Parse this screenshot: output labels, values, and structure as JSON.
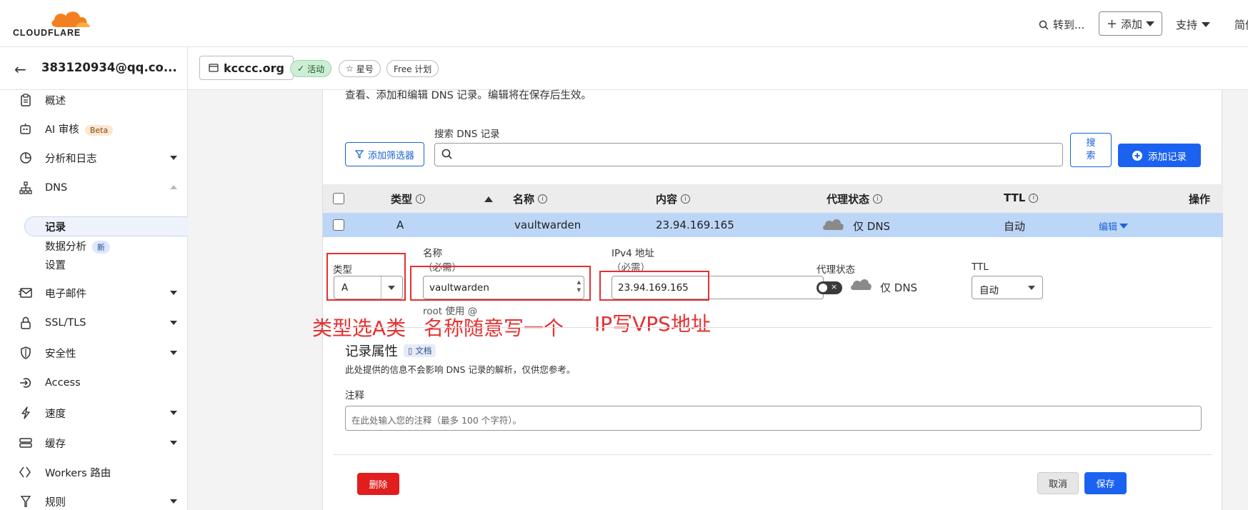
{
  "brand": {
    "wordmark": "CLOUDFLARE",
    "orange": "#f38020"
  },
  "topbar": {
    "goto": "转到...",
    "add": "添加",
    "support": "支持",
    "lang": "简体"
  },
  "account": {
    "email": "383120934@qq.co..."
  },
  "sidebar": {
    "overview": "概述",
    "ai_audit": "AI 审核",
    "beta": "Beta",
    "analytics": "分析和日志",
    "dns": "DNS",
    "records": "记录",
    "dns_analytics": "数据分析",
    "new": "新",
    "settings": "设置",
    "email": "电子邮件",
    "ssl": "SSL/TLS",
    "security": "安全性",
    "access": "Access",
    "speed": "速度",
    "cache": "缓存",
    "workers": "Workers 路由",
    "rules": "规则"
  },
  "domainbar": {
    "domain": "kcccc.org",
    "status": "活动",
    "star": "星号",
    "plan": "Free 计划"
  },
  "dns": {
    "description": "查看、添加和编辑 DNS 记录。编辑将在保存后生效。",
    "search_label": "搜索 DNS 记录",
    "filter_button": "添加筛选器",
    "search_button": "搜索",
    "add_record_button": "添加记录",
    "columns": {
      "type": "类型",
      "name": "名称",
      "content": "内容",
      "proxy": "代理状态",
      "ttl": "TTL",
      "actions": "操作"
    },
    "row": {
      "type": "A",
      "name": "vaultwarden",
      "content": "23.94.169.165",
      "proxy": "仅 DNS",
      "ttl": "自动",
      "edit": "编辑"
    }
  },
  "edit_form": {
    "type_label": "类型",
    "type_value": "A",
    "name_label": "名称",
    "name_required": "（必需）",
    "name_value": "vaultwarden",
    "name_hint": "root 使用 @",
    "ipv4_label": "IPv4 地址",
    "ipv4_required": "（必需）",
    "ipv4_value": "23.94.169.165",
    "proxy_label": "代理状态",
    "proxy_value": "仅 DNS",
    "ttl_label": "TTL",
    "ttl_value": "自动",
    "record_attrs_title": "记录属性",
    "doc_label": "文档",
    "record_attrs_desc": "此处提供的信息不会影响 DNS 记录的解析，仅供您参考。",
    "note_label": "注释",
    "note_placeholder": "在此处输入您的注释（最多 100 个字符）。",
    "delete_button": "删除",
    "cancel_button": "取消",
    "save_button": "保存"
  },
  "annotations": {
    "type_note": "类型选A类",
    "name_note": "名称随意写一个",
    "ip_note": "IP写VPS地址",
    "color": "#e53030"
  }
}
